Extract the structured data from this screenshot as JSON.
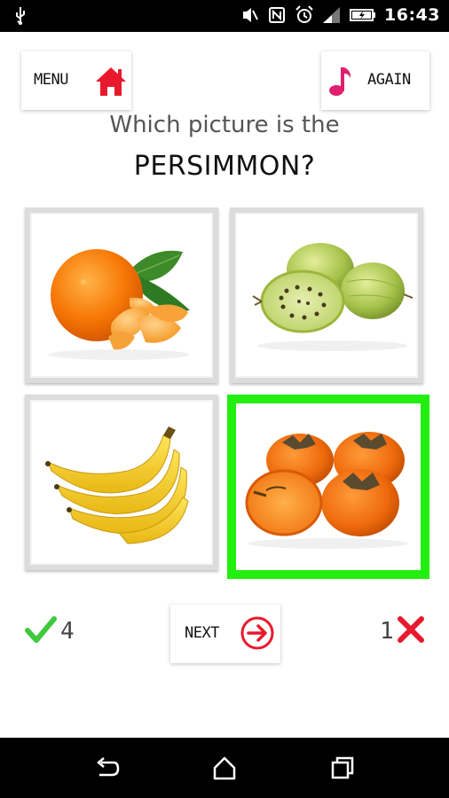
{
  "status_bar": {
    "time": "16:43",
    "icons": [
      "usb-icon",
      "mute-icon",
      "nfc-icon",
      "alarm-icon",
      "signal-icon",
      "battery-charging-icon"
    ]
  },
  "header": {
    "menu_label": "MENU",
    "again_label": "AGAIN",
    "menu_icon": "home-icon",
    "again_icon": "music-note-icon"
  },
  "question": {
    "line1": "Which picture is the",
    "line2": "PERSIMMON?"
  },
  "choices": [
    {
      "icon": "mandarin-picture",
      "selected": false
    },
    {
      "icon": "gooseberry-picture",
      "selected": false
    },
    {
      "icon": "banana-picture",
      "selected": false
    },
    {
      "icon": "persimmon-picture",
      "selected": true
    }
  ],
  "footer": {
    "correct_count": "4",
    "next_label": "NEXT",
    "wrong_count": "1"
  },
  "colors": {
    "accent_red": "#e8192c",
    "highlight_green": "#22ee10",
    "check_green": "#3ec93e",
    "music_pink": "#e0206e"
  },
  "nav_bar": {
    "icons": [
      "back-icon",
      "home-nav-icon",
      "recents-icon"
    ]
  }
}
